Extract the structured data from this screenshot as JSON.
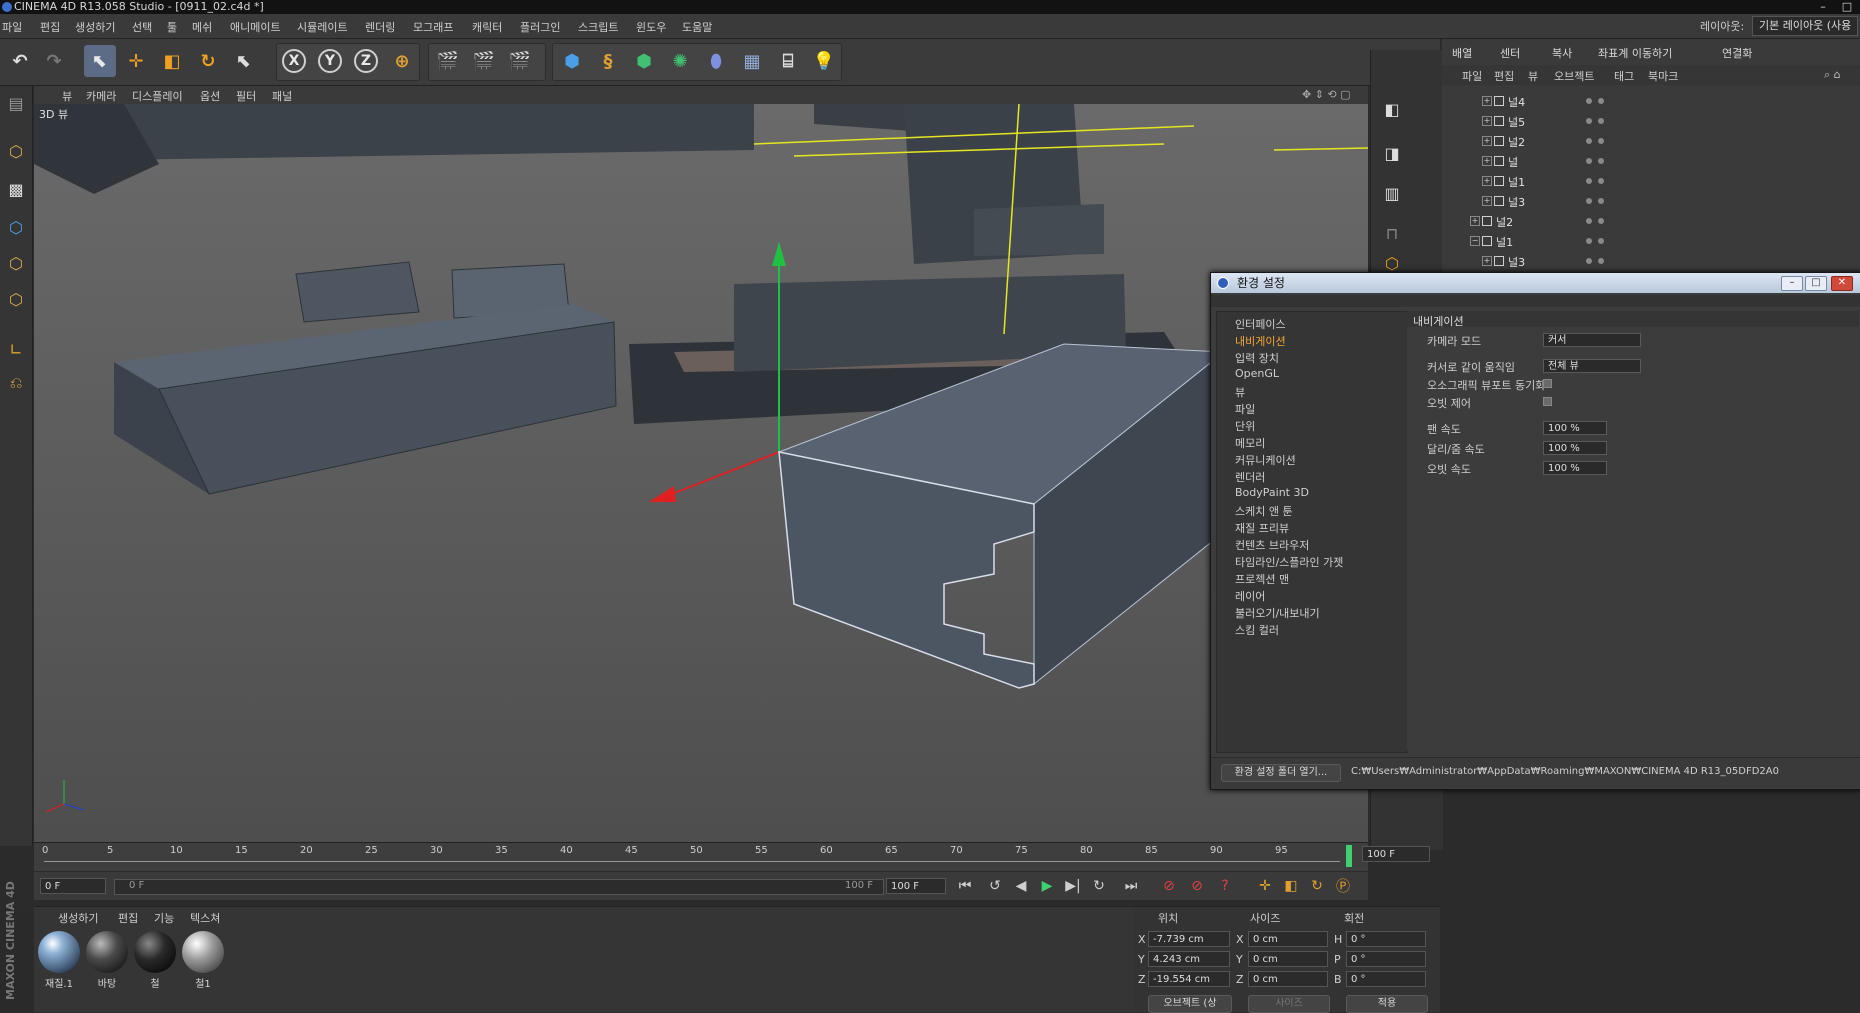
{
  "window": {
    "title": "CINEMA 4D R13.058 Studio - [0911_02.c4d *]",
    "min": "–",
    "max": "□",
    "close": "✕"
  },
  "menu": [
    "파일",
    "편집",
    "생성하기",
    "선택",
    "툴",
    "메쉬",
    "애니메이트",
    "시뮬레이트",
    "렌더링",
    "모그래프",
    "캐릭터",
    "플러그인",
    "스크립트",
    "윈도우",
    "도움말"
  ],
  "layout": {
    "label": "레이아웃:",
    "value": "기본 레이아웃 (사용"
  },
  "toolbar": {
    "axes": [
      "X",
      "Y",
      "Z"
    ],
    "icons": [
      "undo-icon",
      "redo-icon",
      "live-select-icon",
      "move-icon",
      "scale-icon",
      "rotate-icon",
      "recent-tool-icon",
      "x-axis-icon",
      "y-axis-icon",
      "z-axis-icon",
      "world-coord-icon",
      "render-view-icon",
      "render-picture-viewer-icon",
      "render-settings-icon",
      "cube-icon",
      "spline-icon",
      "nurbs-icon",
      "array-icon",
      "deformer-icon",
      "floor-icon",
      "camera-icon",
      "light-icon"
    ]
  },
  "viewport": {
    "menu": [
      "뷰",
      "카메라",
      "디스플레이",
      "옵션",
      "필터",
      "패널"
    ],
    "label": "3D 뷰"
  },
  "object_manager": {
    "tabs": [
      "배열",
      "센터",
      "복사",
      "좌표계 이동하기",
      "연결화"
    ],
    "menu": [
      "파일",
      "편집",
      "뷰",
      "오브젝트",
      "태그",
      "북마크"
    ],
    "objects": [
      {
        "name": "널4",
        "expanded": false
      },
      {
        "name": "널5",
        "expanded": false
      },
      {
        "name": "널2",
        "expanded": false
      },
      {
        "name": "널",
        "expanded": false
      },
      {
        "name": "널1",
        "expanded": false
      },
      {
        "name": "널3",
        "expanded": false
      },
      {
        "name": "널2",
        "expanded": true
      },
      {
        "name": "널1",
        "expanded": true
      },
      {
        "name": "널3",
        "expanded": false
      }
    ]
  },
  "timeline": {
    "ticks": [
      "0",
      "5",
      "10",
      "15",
      "20",
      "25",
      "30",
      "35",
      "40",
      "45",
      "50",
      "55",
      "60",
      "65",
      "70",
      "75",
      "80",
      "85",
      "90",
      "95",
      "100"
    ],
    "end_field": "100 F",
    "current_frame": "0 F",
    "range_start": "0 F",
    "range_end": "100 F",
    "max_field": "100 F"
  },
  "materials": {
    "menu": [
      "생성하기",
      "편집",
      "기능",
      "텍스쳐"
    ],
    "items": [
      {
        "name": "재질.1",
        "color": "#8fb3d6"
      },
      {
        "name": "바탕",
        "color": "#4a4a4a"
      },
      {
        "name": "철",
        "color": "#2a2a2a"
      },
      {
        "name": "철1",
        "color": "#9a9a9a"
      }
    ]
  },
  "coordinates": {
    "headers": [
      "위치",
      "사이즈",
      "회전"
    ],
    "rows": [
      {
        "axis": "X",
        "pos": "-7.739 cm",
        "size_axis": "X",
        "size": "0 cm",
        "rot_axis": "H",
        "rot": "0 °"
      },
      {
        "axis": "Y",
        "pos": "4.243 cm",
        "size_axis": "Y",
        "size": "0 cm",
        "rot_axis": "P",
        "rot": "0 °"
      },
      {
        "axis": "Z",
        "pos": "-19.554 cm",
        "size_axis": "Z",
        "size": "0 cm",
        "rot_axis": "B",
        "rot": "0 °"
      }
    ],
    "mode": "오브젝트 (상",
    "size_mode": "사이즈",
    "apply": "적용"
  },
  "brand": "MAXON CINEMA 4D",
  "prefs": {
    "title": "환경 설정",
    "categories": [
      {
        "label": "인터페이스",
        "active": false
      },
      {
        "label": "내비게이션",
        "active": true
      },
      {
        "label": "입력 장치",
        "active": false
      },
      {
        "label": "OpenGL",
        "active": false
      },
      {
        "label": "뷰",
        "active": false
      },
      {
        "label": "파일",
        "active": false
      },
      {
        "label": "단위",
        "active": false
      },
      {
        "label": "메모리",
        "active": false
      },
      {
        "label": "커뮤니케이션",
        "active": false
      },
      {
        "label": "렌더러",
        "active": false
      },
      {
        "label": "BodyPaint 3D",
        "active": false
      },
      {
        "label": "스케치 앤 툰",
        "active": false
      },
      {
        "label": "재질 프리뷰",
        "active": false
      },
      {
        "label": "컨텐츠 브라우저",
        "active": false
      },
      {
        "label": "타임라인/스플라인 가젯",
        "active": false
      },
      {
        "label": "프로젝션 맨",
        "active": false
      },
      {
        "label": "레이어",
        "active": false
      },
      {
        "label": "불러오기/내보내기",
        "active": false
      },
      {
        "label": "스킴 컬러",
        "active": false
      }
    ],
    "section": "내비게이션",
    "camera_mode_label": "카메라 모드",
    "camera_mode_value": "커서",
    "cursor_move_label": "커서로 같이 움직임",
    "cursor_move_value": "전체 뷰",
    "ortho_sync_label": "오소그래픽 뷰포트 동기화",
    "orbit_label": "오빗 제어",
    "pan_speed_label": "팬 속도",
    "pan_speed": "100 %",
    "dolly_speed_label": "달리/줌 속도",
    "dolly_speed": "100 %",
    "orbit_speed_label": "오빗 속도",
    "orbit_speed": "100 %",
    "open_folder": "환경 설정 폴더 열기...",
    "path": "C:₩Users₩Administrator₩AppData₩Roaming₩MAXON₩CINEMA 4D R13_05DFD2A0"
  },
  "colors": {
    "accent": "#f0a838",
    "axis_x": "#e02020",
    "axis_y": "#20c040",
    "axis_z": "#2040e0",
    "select": "#5d6c86"
  }
}
